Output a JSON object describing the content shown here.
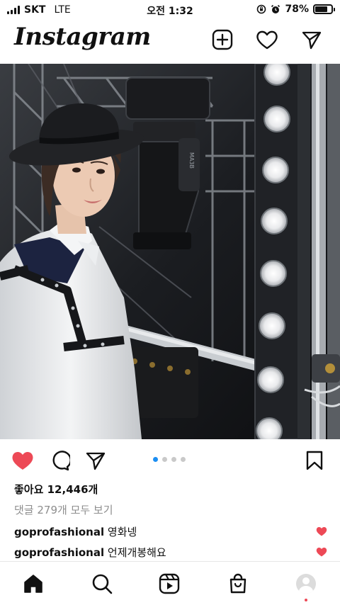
{
  "status_bar": {
    "carrier": "SKT",
    "network": "LTE",
    "time": "오전 1:32",
    "battery_text": "78%",
    "battery_level": 0.78
  },
  "header": {
    "logo": "Instagram",
    "icons": [
      "new-post-icon",
      "heart-icon",
      "direct-message-icon"
    ]
  },
  "post": {
    "carousel_count": 4,
    "carousel_active_index": 0,
    "likes_text": "좋아요 12,446개",
    "comments_link": "댓글 279개 모두 보기",
    "comments": [
      {
        "user": "goprofashional",
        "text": "영화넹"
      },
      {
        "user": "goprofashional",
        "text": "언제개봉해요"
      }
    ]
  },
  "colors": {
    "like_red": "#ed4956",
    "carousel_active": "#1c8ef2"
  },
  "bottom_nav": [
    "home-icon",
    "search-icon",
    "reels-icon",
    "shop-icon",
    "profile-avatar"
  ]
}
